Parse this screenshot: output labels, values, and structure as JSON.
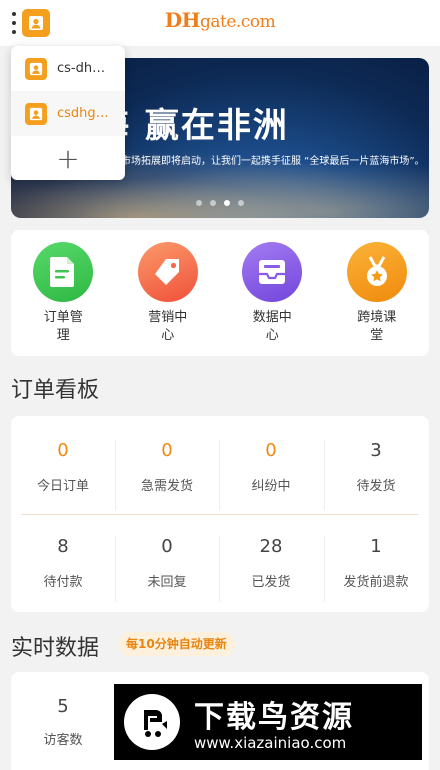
{
  "header": {
    "logo_main": "DH",
    "logo_rest": "gate.com"
  },
  "banner": {
    "headline": "展蓝海  赢在非洲",
    "subtitle": "市场拓展即将启动，让我们一起携手征服 “全球最后一片蓝海市场”。",
    "slide_count": 4,
    "active_slide_index": 2
  },
  "account_popup": {
    "accounts": [
      {
        "name": "cs-dh…",
        "selected": false
      },
      {
        "name": "csdhg…",
        "selected": true
      }
    ],
    "add_label": "+"
  },
  "menu": [
    {
      "label": "订单管理",
      "icon": "order-document-icon",
      "color": "#3ec64f"
    },
    {
      "label": "营销中心",
      "icon": "marketing-tag-icon",
      "color": "#f26a4a"
    },
    {
      "label": "数据中心",
      "icon": "data-inbox-icon",
      "color": "#8a5ae8"
    },
    {
      "label": "跨境课堂",
      "icon": "medal-star-icon",
      "color": "#f59a12"
    }
  ],
  "order_board": {
    "title": "订单看板",
    "cells": [
      {
        "value": "0",
        "label": "今日订单",
        "highlight": true
      },
      {
        "value": "0",
        "label": "急需发货",
        "highlight": true
      },
      {
        "value": "0",
        "label": "纠纷中",
        "highlight": true
      },
      {
        "value": "3",
        "label": "待发货",
        "highlight": false
      },
      {
        "value": "8",
        "label": "待付款",
        "highlight": false
      },
      {
        "value": "0",
        "label": "未回复",
        "highlight": false
      },
      {
        "value": "28",
        "label": "已发货",
        "highlight": false
      },
      {
        "value": "1",
        "label": "发货前退款",
        "highlight": false
      }
    ]
  },
  "realtime": {
    "title": "实时数据",
    "badge": "每10分钟自动更新",
    "visitors_value": "5",
    "visitors_label": "访客数"
  },
  "watermark": {
    "title": "下载鸟资源",
    "url": "www.xiazainiao.com"
  },
  "colors": {
    "accent": "#f08a12",
    "account_orange": "#f59f1f"
  }
}
